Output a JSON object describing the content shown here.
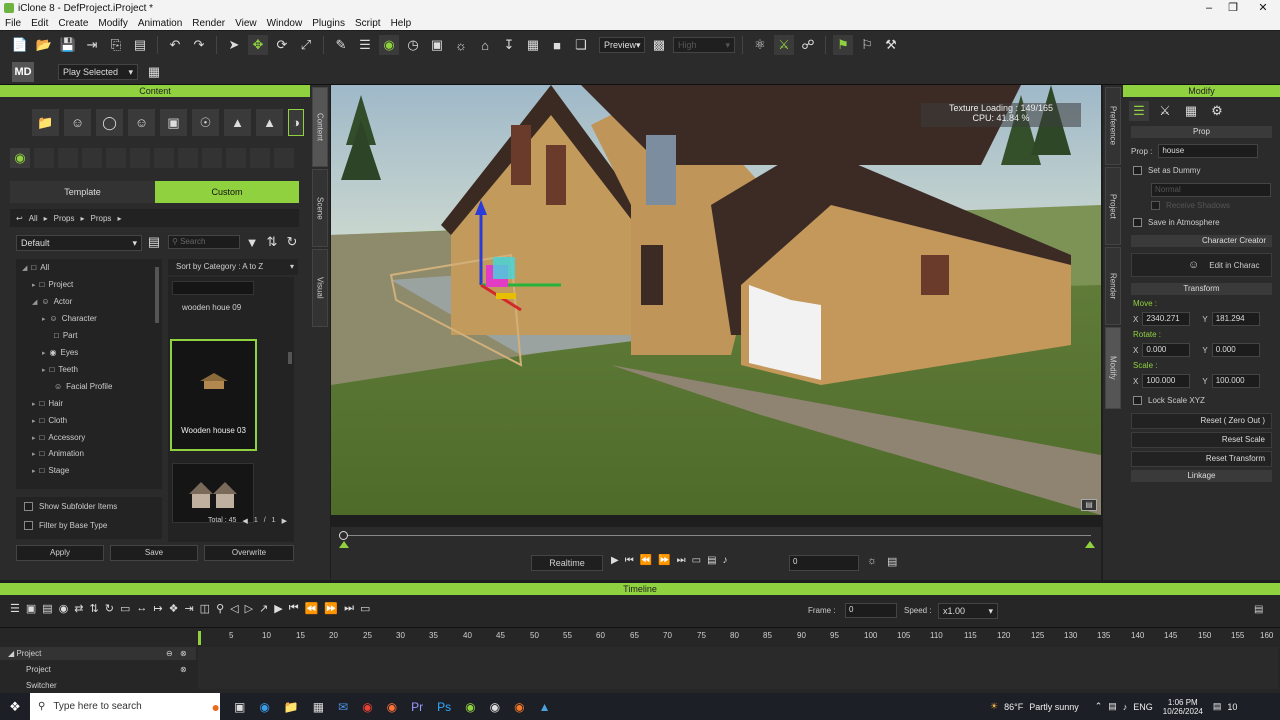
{
  "window": {
    "title": "iClone 8 - DefProject.iProject *"
  },
  "menu": [
    "File",
    "Edit",
    "Create",
    "Modify",
    "Animation",
    "Render",
    "View",
    "Window",
    "Plugins",
    "Script",
    "Help"
  ],
  "toolbar": {
    "preview_label": "Preview",
    "quality_label": "High",
    "play_selected_label": "Play Selected"
  },
  "content_panel": {
    "title": "Content",
    "tabs": {
      "template": "Template",
      "custom": "Custom"
    },
    "breadcrumb": [
      "All",
      "Props",
      "Props"
    ],
    "filter_value": "Default",
    "search_placeholder": "Search",
    "sort_label": "Sort by Category : A to Z",
    "tree": [
      {
        "label": "All",
        "level": 0
      },
      {
        "label": "Project",
        "level": 1
      },
      {
        "label": "Actor",
        "level": 1
      },
      {
        "label": "Character",
        "level": 2
      },
      {
        "label": "Part",
        "level": 2
      },
      {
        "label": "Eyes",
        "level": 2
      },
      {
        "label": "Teeth",
        "level": 2
      },
      {
        "label": "Facial Profile",
        "level": 2
      },
      {
        "label": "Hair",
        "level": 1
      },
      {
        "label": "Cloth",
        "level": 1
      },
      {
        "label": "Accessory",
        "level": 1
      },
      {
        "label": "Animation",
        "level": 1
      },
      {
        "label": "Stage",
        "level": 1
      }
    ],
    "items": [
      {
        "label": "wooden houe 09"
      },
      {
        "label": "Wooden house 03"
      },
      {
        "label": ""
      }
    ],
    "total_label": "Total : 45",
    "page_current": "1",
    "page_sep": "/",
    "page_total": "1",
    "show_subfolder_label": "Show Subfolder Items",
    "filter_base_label": "Filter by Base Type",
    "apply_label": "Apply",
    "save_label": "Save",
    "overwrite_label": "Overwrite"
  },
  "side_tabs": {
    "content": "Content",
    "scene": "Scene",
    "visual": "Visual"
  },
  "right_tabs": {
    "preference": "Preference",
    "project": "Project",
    "render": "Render",
    "modify": "Modify"
  },
  "viewport": {
    "texture_loading": "Texture Loading : 149/165",
    "cpu": "CPU: 41.84 %"
  },
  "modify_panel": {
    "title": "Modify",
    "prop_section": "Prop",
    "prop_label": "Prop :",
    "prop_name": "house",
    "set_as_dummy": "Set as Dummy",
    "normal_label": "Normal",
    "receive_shadows": "Receive Shadows",
    "save_in_atmosphere": "Save in Atmosphere",
    "character_creator": "Character Creator",
    "edit_in_cc": "Edit in Charac",
    "transform": "Transform",
    "move_label": "Move :",
    "move_x": "2340.271",
    "move_y": "181.294",
    "rotate_label": "Rotate :",
    "rotate_x": "0.000",
    "rotate_y": "0.000",
    "scale_label": "Scale :",
    "scale_x": "100.000",
    "scale_y": "100.000",
    "lock_scale": "Lock Scale XYZ",
    "reset_zero": "Reset ( Zero Out )",
    "reset_scale": "Reset Scale",
    "reset_transform": "Reset Transform",
    "linkage": "Linkage",
    "x_label": "X",
    "y_label": "Y"
  },
  "playbar": {
    "mode": "Realtime",
    "frame": "0"
  },
  "timeline": {
    "title": "Timeline",
    "frame_label": "Frame :",
    "frame_value": "0",
    "speed_label": "Speed :",
    "speed_value": "x1.00",
    "ruler": [
      "5",
      "10",
      "15",
      "20",
      "25",
      "30",
      "35",
      "40",
      "45",
      "50",
      "55",
      "60",
      "65",
      "70",
      "75",
      "80",
      "85",
      "90",
      "95",
      "100",
      "105",
      "110",
      "115",
      "120",
      "125",
      "130",
      "135",
      "140",
      "145",
      "150",
      "155",
      "160"
    ],
    "tracks": [
      "Project",
      "Project",
      "Switcher"
    ]
  },
  "taskbar": {
    "search_placeholder": "Type here to search",
    "temp": "86°F",
    "weather": "Partly sunny",
    "lang": "ENG",
    "time": "1:06 PM",
    "date": "10/26/2024",
    "notif": "10"
  }
}
